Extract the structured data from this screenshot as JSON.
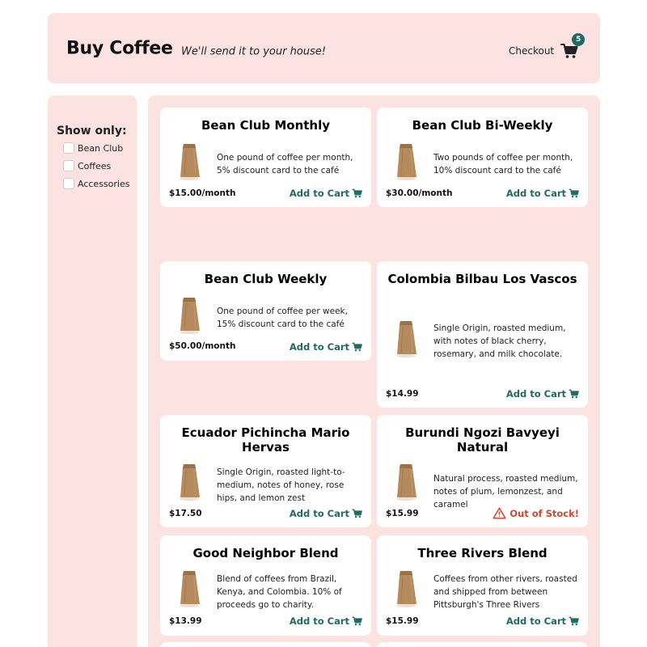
{
  "header": {
    "title": "Buy Coffee",
    "tagline": "We'll send it to your house!",
    "checkout_label": "Checkout",
    "cart_count": "5",
    "cart_icon": "shopping-cart-icon"
  },
  "sidebar": {
    "show_only_label": "Show only:",
    "filters": [
      {
        "label": "Bean Club",
        "checked": false
      },
      {
        "label": "Coffees",
        "checked": false
      },
      {
        "label": "Accessories",
        "checked": false
      }
    ]
  },
  "colors": {
    "panel_bg": "#fde2e2",
    "accent": "#1f6b63",
    "out_of_stock": "#d9452c"
  },
  "products": [
    {
      "name": "Bean Club Monthly",
      "description": "One pound of coffee per month, 5% discount card to the café",
      "price": "$15.00/month",
      "action": "Add to Cart",
      "in_stock": true
    },
    {
      "name": "Bean Club Bi-Weekly",
      "description": "Two pounds of coffee per month, 10% discount card to the café",
      "price": "$30.00/month",
      "action": "Add to Cart",
      "in_stock": true
    },
    {
      "name": "Bean Club Weekly",
      "description": "One pound of coffee per week, 15% discount card to the café",
      "price": "$50.00/month",
      "action": "Add to Cart",
      "in_stock": true
    },
    {
      "name": "Colombia Bilbau Los Vascos",
      "description": "Single Origin, roasted medium, with notes of black cherry, rosemary, and milk chocolate.",
      "price": "$14.99",
      "action": "Add to Cart",
      "in_stock": true
    },
    {
      "name": "Ecuador Pichincha Mario Hervas",
      "description": "Single Origin, roasted light-to-medium, notes of honey, rose hips, and lemon zest",
      "price": "$17.50",
      "action": "Add to Cart",
      "in_stock": true
    },
    {
      "name": "Burundi Ngozi Bavyeyi Natural",
      "description": "Natural process, roasted medium, notes of plum, lemonzest, and caramel",
      "price": "$15.99",
      "action": "Out of Stock!",
      "in_stock": false
    },
    {
      "name": "Good Neighbor Blend",
      "description": "Blend of coffees from Brazil, Kenya, and Colombia. 10% of proceeds go to charity.",
      "price": "$13.99",
      "action": "Add to Cart",
      "in_stock": true
    },
    {
      "name": "Three Rivers Blend",
      "description": "Coffees from other rivers, roasted and shipped from between Pittsburgh's Three Rivers",
      "price": "$15.99",
      "action": "Add to Cart",
      "in_stock": true
    }
  ]
}
